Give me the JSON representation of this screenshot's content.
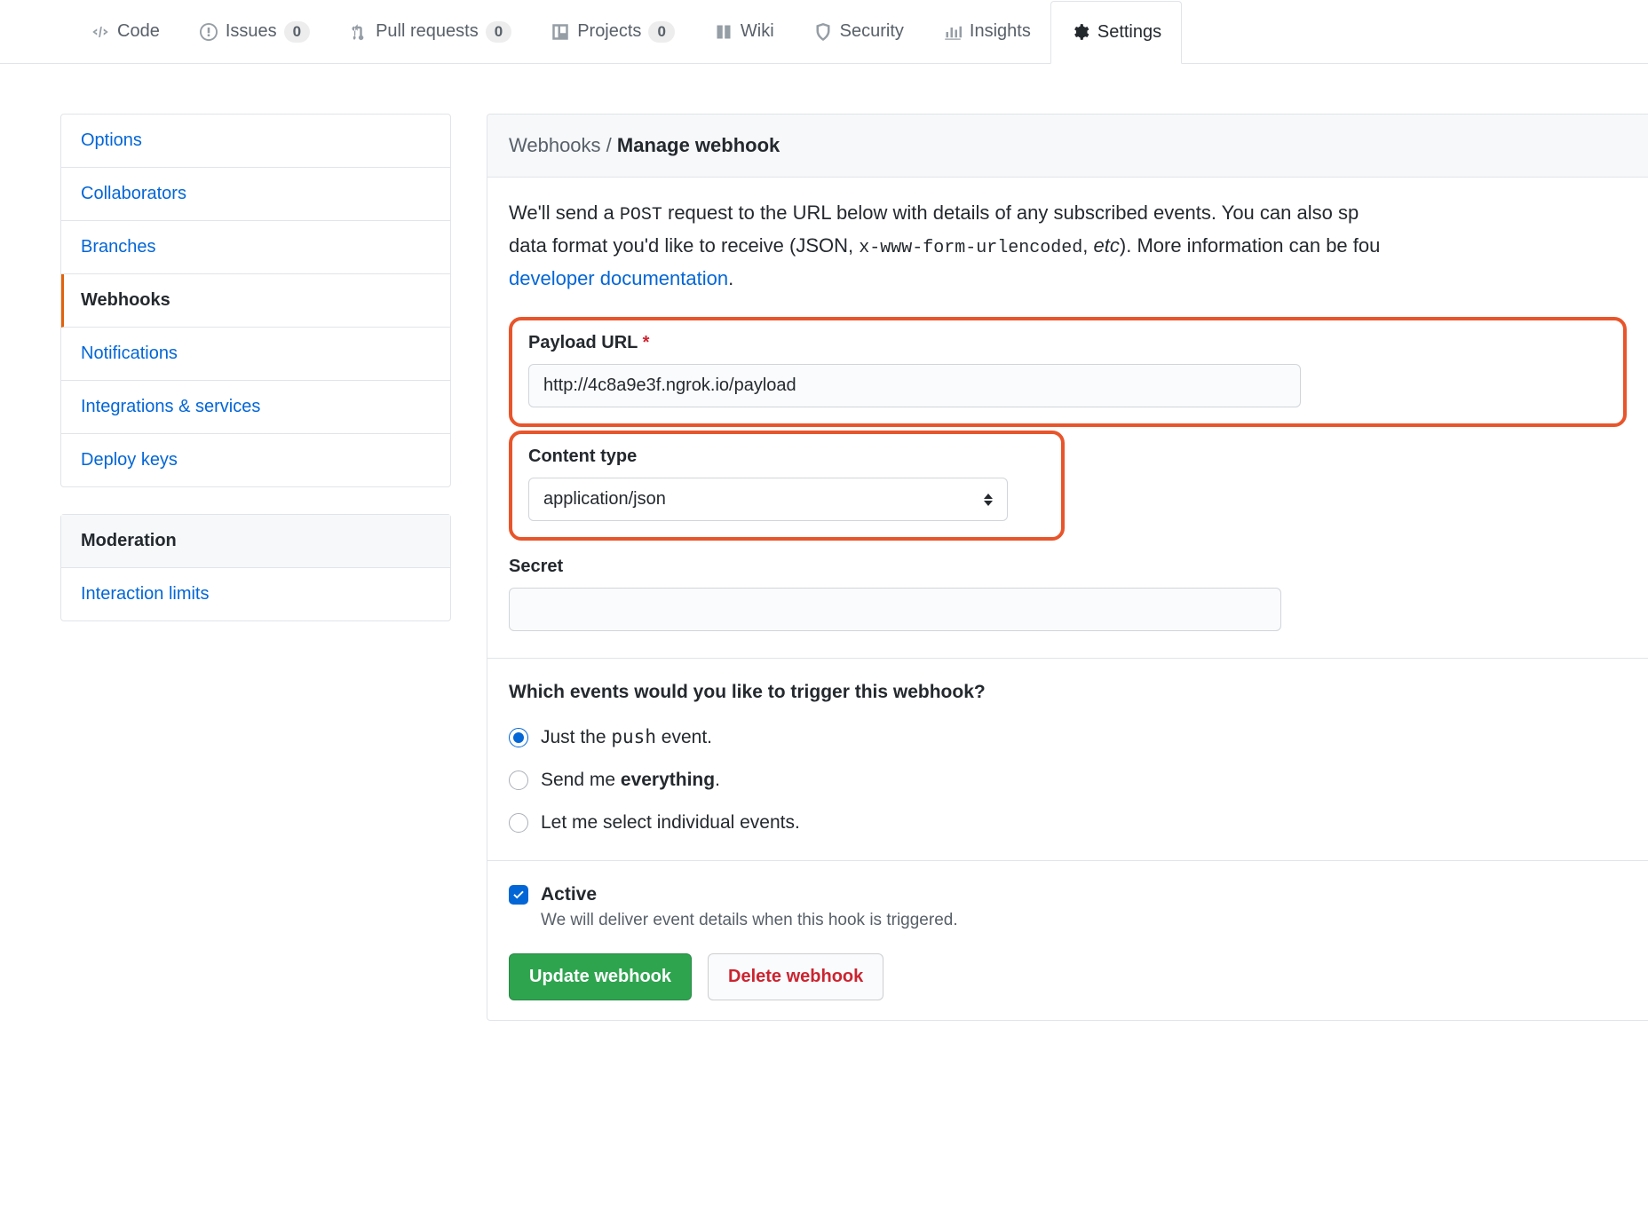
{
  "tabs": {
    "code": "Code",
    "issues": "Issues",
    "issues_count": "0",
    "pulls": "Pull requests",
    "pulls_count": "0",
    "projects": "Projects",
    "projects_count": "0",
    "wiki": "Wiki",
    "security": "Security",
    "insights": "Insights",
    "settings": "Settings"
  },
  "sidebar": {
    "options": "Options",
    "collaborators": "Collaborators",
    "branches": "Branches",
    "webhooks": "Webhooks",
    "notifications": "Notifications",
    "integrations": "Integrations & services",
    "deploy_keys": "Deploy keys",
    "moderation_header": "Moderation",
    "interaction_limits": "Interaction limits"
  },
  "breadcrumb": {
    "parent": "Webhooks",
    "sep": " / ",
    "current": "Manage webhook"
  },
  "intro": {
    "p1a": "We'll send a ",
    "p1_code1": "POST",
    "p1b": " request to the URL below with details of any subscribed events. You can also sp",
    "p2a": "data format you'd like to receive (JSON, ",
    "p2_code1": "x-www-form-urlencoded",
    "p2b": ", ",
    "p2_em": "etc",
    "p2c": "). More information can be fou",
    "link": "developer documentation",
    "p3": "."
  },
  "form": {
    "payload_url_label": "Payload URL",
    "payload_url_value": "http://4c8a9e3f.ngrok.io/payload",
    "content_type_label": "Content type",
    "content_type_value": "application/json",
    "secret_label": "Secret",
    "secret_value": "",
    "events_question": "Which events would you like to trigger this webhook?",
    "radio1_pre": "Just the ",
    "radio1_code": "push",
    "radio1_post": " event.",
    "radio2_pre": "Send me ",
    "radio2_strong": "everything",
    "radio2_post": ".",
    "radio3": "Let me select individual events.",
    "active_label": "Active",
    "active_desc": "We will deliver event details when this hook is triggered.",
    "update_btn": "Update webhook",
    "delete_btn": "Delete webhook"
  }
}
